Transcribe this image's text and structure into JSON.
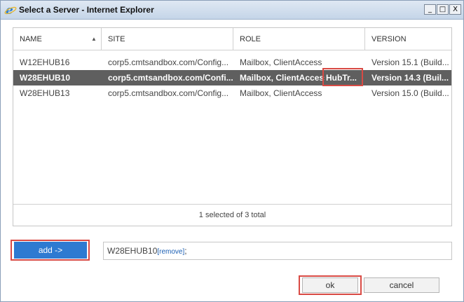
{
  "window": {
    "title": "Select a Server - Internet Explorer",
    "controls": {
      "minimize": "_",
      "maximize": "□",
      "close": "X"
    }
  },
  "grid": {
    "columns": [
      "NAME",
      "SITE",
      "ROLE",
      "VERSION"
    ],
    "rows": [
      {
        "name": "W12EHUB16",
        "site": "corp5.cmtsandbox.com/Config...",
        "role": "Mailbox, ClientAccess",
        "role_extra": "",
        "version": "Version 15.1 (Build..."
      },
      {
        "name": "W28EHUB10",
        "site": "corp5.cmtsandbox.com/Confi...",
        "role": "Mailbox, ClientAccess",
        "role_extra": "HubTr...",
        "version": "Version 14.3 (Buil..."
      },
      {
        "name": "W28EHUB13",
        "site": "corp5.cmtsandbox.com/Config...",
        "role": "Mailbox, ClientAccess",
        "role_extra": "",
        "version": "Version 15.0 (Build..."
      }
    ],
    "selected_row": 1,
    "footer": "1 selected of 3 total"
  },
  "picker": {
    "add_label": "add ->",
    "selected_value": "W28EHUB10",
    "remove_label": "[remove]",
    "separator": ";"
  },
  "actions": {
    "ok_label": "ok",
    "cancel_label": "cancel"
  },
  "colors": {
    "accent": "#2e7ad1",
    "selection": "#5f5f5f",
    "highlight": "#d94a44"
  },
  "icons": {
    "app": "internet-explorer-icon",
    "sort": "sort-ascending-icon"
  }
}
